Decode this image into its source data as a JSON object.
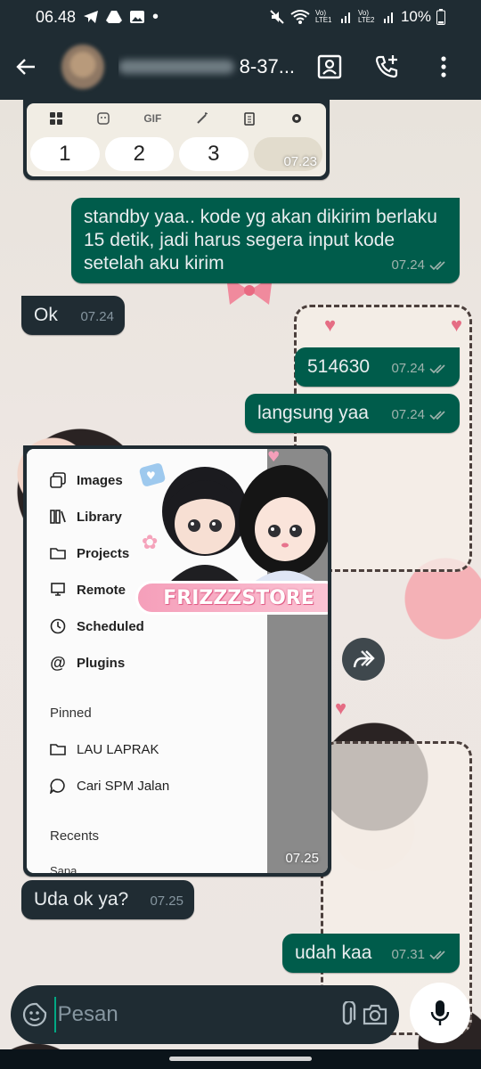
{
  "status_bar": {
    "time": "06.48",
    "battery": "10%",
    "sim1": "Vo) LTE1",
    "sim2": "Vo) LTE2",
    "icons": [
      "telegram-icon",
      "drive-icon",
      "image-icon",
      "dot-icon",
      "mute-icon",
      "wifi-icon",
      "signal-icon",
      "battery-icon"
    ]
  },
  "header": {
    "contact_name_visible": "8-37...",
    "icons": [
      "back-arrow-icon",
      "contact-card-icon",
      "add-call-icon",
      "more-vert-icon"
    ]
  },
  "keyboard_image": {
    "toolbar": [
      "grid-icon",
      "sticker-icon",
      "GIF",
      "magic-wand-icon",
      "clipboard-icon",
      "settings-icon"
    ],
    "keys": [
      "1",
      "2",
      "3",
      ""
    ],
    "time": "07.23"
  },
  "messages": [
    {
      "id": "m1",
      "direction": "out",
      "text": "standby yaa.. kode yg akan dikirim berlaku 15 detik, jadi harus segera input kode setelah aku kirim",
      "time": "07.24",
      "status": "read"
    },
    {
      "id": "m2",
      "direction": "in",
      "text": "Ok",
      "time": "07.24"
    },
    {
      "id": "m3",
      "direction": "out",
      "text": "514630",
      "time": "07.24",
      "status": "read"
    },
    {
      "id": "m4",
      "direction": "out",
      "text": "langsung yaa",
      "time": "07.24",
      "status": "read"
    },
    {
      "id": "m5",
      "direction": "in",
      "text": "Uda ok ya?",
      "time": "07.25"
    },
    {
      "id": "m6",
      "direction": "out",
      "text": "udah kaa",
      "time": "07.31",
      "status": "read"
    }
  ],
  "menu_image": {
    "items": [
      {
        "label": "Images",
        "icon": "images-icon"
      },
      {
        "label": "Library",
        "icon": "library-icon"
      },
      {
        "label": "Projects",
        "icon": "folder-icon"
      },
      {
        "label": "Remote",
        "icon": "remote-icon"
      },
      {
        "label": "Scheduled",
        "icon": "clock-icon"
      },
      {
        "label": "Plugins",
        "icon": "at-icon"
      }
    ],
    "pinned_heading": "Pinned",
    "pinned": [
      {
        "label": "LAU LAPRAK",
        "icon": "folder-icon"
      },
      {
        "label": "Cari SPM Jalan",
        "icon": "chat-bubble-icon"
      }
    ],
    "recents_heading": "Recents",
    "recents_partial": "Sapa",
    "watermark": "FRIZZZSTORE",
    "time": "07.25"
  },
  "input": {
    "placeholder": "Pesan"
  },
  "colors": {
    "header_bg": "#1f2c33",
    "outgoing_bubble": "#005c4b",
    "incoming_bubble": "#202c33",
    "accent": "#00a884"
  }
}
